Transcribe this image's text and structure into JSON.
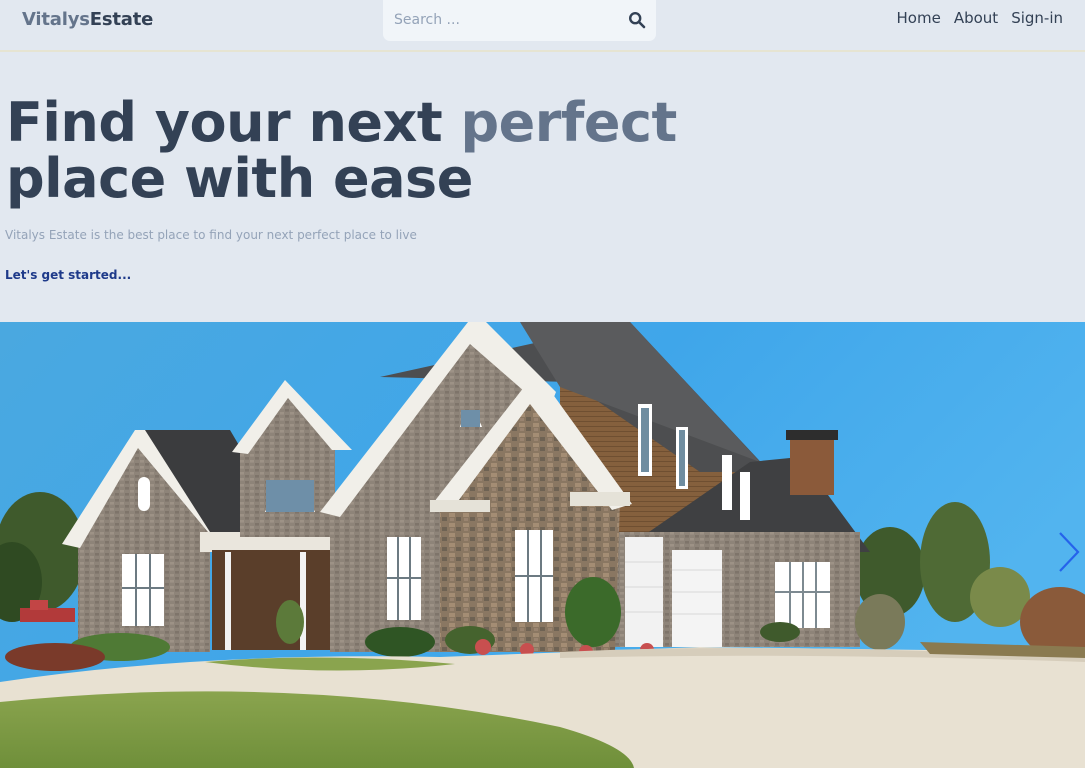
{
  "header": {
    "logo_part1": "Vitalys",
    "logo_part2": "Estate",
    "search_placeholder": "Search ...",
    "nav": [
      "Home",
      "About",
      "Sign-in"
    ]
  },
  "hero": {
    "title_main": "Find your next ",
    "title_accent": "perfect",
    "title_line2": "place with ease",
    "subtitle": "Vitalys Estate is the best place to find your next perfect place to live",
    "cta": "Let's get started..."
  },
  "carousel": {
    "image_subject": "house-photo",
    "next_icon": "chevron-right-icon"
  },
  "colors": {
    "background": "#e2e8f0",
    "text_dark": "#334155",
    "text_accent": "#64748b",
    "link": "#1e3a8a",
    "arrow": "#2563eb"
  }
}
